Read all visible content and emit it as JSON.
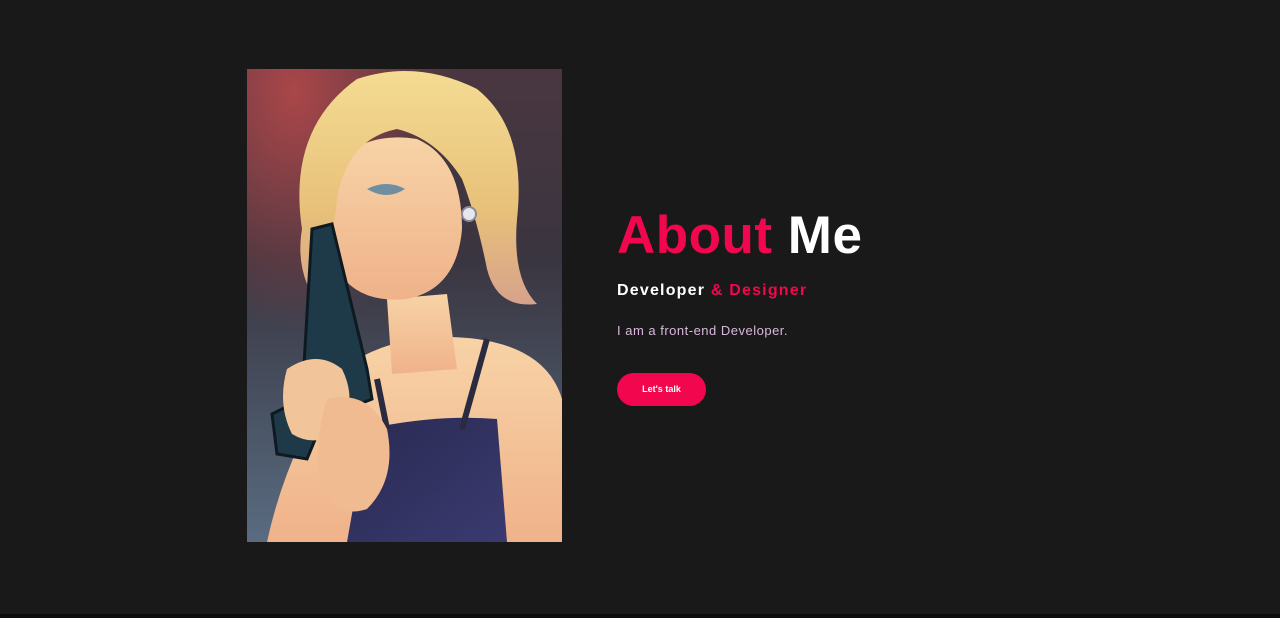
{
  "about": {
    "title_accent": "About",
    "title_rest": "Me",
    "role_primary": "Developer",
    "role_secondary": "& Designer",
    "bio": "I am a front-end Developer.",
    "cta_label": "Let's talk"
  },
  "colors": {
    "background": "#191919",
    "accent": "#f2074f",
    "text": "#ffffff",
    "bio_text": "#d9b8dc"
  },
  "image": {
    "subject": "anime illustration of a blonde woman holding a handgun"
  }
}
